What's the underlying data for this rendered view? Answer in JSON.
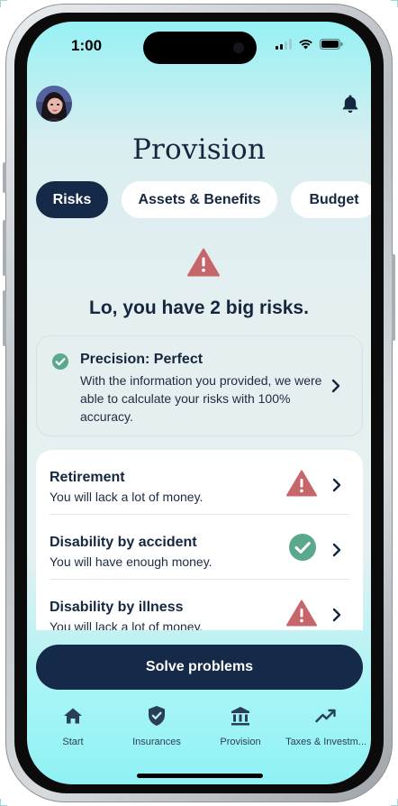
{
  "status_bar": {
    "time": "1:00"
  },
  "header": {
    "title": "Provision"
  },
  "tabs": [
    {
      "label": "Risks",
      "active": true
    },
    {
      "label": "Assets & Benefits",
      "active": false
    },
    {
      "label": "Budget",
      "active": false
    }
  ],
  "summary": {
    "headline": "Lo, you have 2 big risks."
  },
  "precision": {
    "title": "Precision: Perfect",
    "description": "With the information you provided, we were able to calculate your risks with 100% accuracy."
  },
  "risks": [
    {
      "title": "Retirement",
      "subtitle": "You will lack a lot of money.",
      "status": "warning-icon"
    },
    {
      "title": "Disability by accident",
      "subtitle": "You will have enough money.",
      "status": "check-circle-icon"
    },
    {
      "title": "Disability by illness",
      "subtitle": "You will lack a lot of money.",
      "status": "warning-icon"
    }
  ],
  "cta": {
    "label": "Solve problems"
  },
  "nav": [
    {
      "label": "Start",
      "icon": "home-icon"
    },
    {
      "label": "Insurances",
      "icon": "shield-check-icon"
    },
    {
      "label": "Provision",
      "icon": "bank-icon"
    },
    {
      "label": "Taxes & Investm...",
      "icon": "trending-up-icon"
    }
  ],
  "colors": {
    "primary_navy": "#152a48",
    "warning_red": "#c7666a",
    "success_green": "#5aa98c",
    "background_cyan": "#96f1f4"
  }
}
